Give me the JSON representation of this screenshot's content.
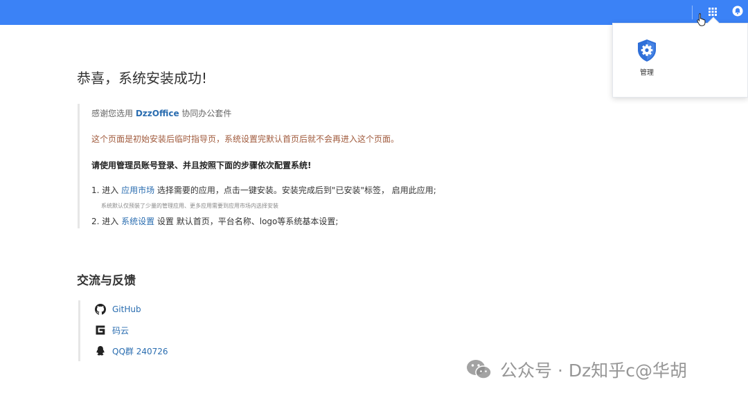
{
  "topbar": {
    "color": "#3b82f6",
    "grid_icon": "apps-grid-icon",
    "bell_icon": "notification-bell-icon"
  },
  "dropdown": {
    "apps": [
      {
        "label": "管理",
        "icon": "admin-gear-shield-icon"
      }
    ]
  },
  "main": {
    "title": "恭喜，系统安装成功!",
    "notice": {
      "thanks_prefix": "感谢您选用 ",
      "brand": "DzzOffice",
      "thanks_suffix": " 协同办公套件",
      "warning": "这个页面是初始安装后临时指导页，系统设置完默认首页后就不会再进入这个页面。",
      "instruction": "请使用管理员账号登录、并且按照下面的步骤依次配置系统!",
      "step1_prefix": "1. 进入 ",
      "step1_link": "应用市场",
      "step1_suffix": " 选择需要的应用，点击一键安装。安装完成后到\"已安装\"标签， 启用此应用;",
      "step1_note": "系统默认仅预装了少量的管理应用、更多应用需要到应用市场内选择安装",
      "step2_prefix": "2. 进入 ",
      "step2_link": "系统设置",
      "step2_suffix": " 设置 默认首页，平台名称、logo等系统基本设置;"
    }
  },
  "feedback": {
    "title": "交流与反馈",
    "links": [
      {
        "label": "GitHub",
        "icon": "github-icon"
      },
      {
        "label": "码云",
        "icon": "gitee-icon"
      },
      {
        "label": "QQ群 240726",
        "icon": "qq-icon"
      }
    ]
  },
  "watermark": {
    "text": "公众号 · Dz知乎c@华胡"
  }
}
